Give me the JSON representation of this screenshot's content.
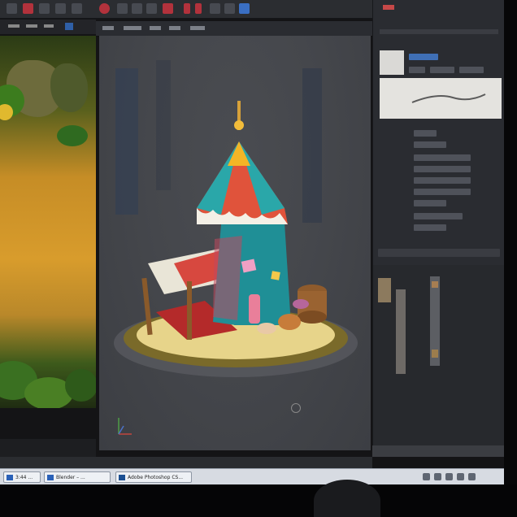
{
  "taskbar": {
    "items": [
      {
        "label": "3:44 ...",
        "icon": "folder-icon"
      },
      {
        "label": "Blender – ...",
        "icon": "app-window-icon"
      },
      {
        "label": "Adobe Photoshop CS...",
        "icon": "photoshop-icon"
      }
    ]
  },
  "colors": {
    "accent": "#c64848",
    "tent_teal": "#2aa7a9",
    "tent_red": "#e0533b",
    "tent_yellow": "#f3b526",
    "viewport_bg": "#45474c"
  }
}
